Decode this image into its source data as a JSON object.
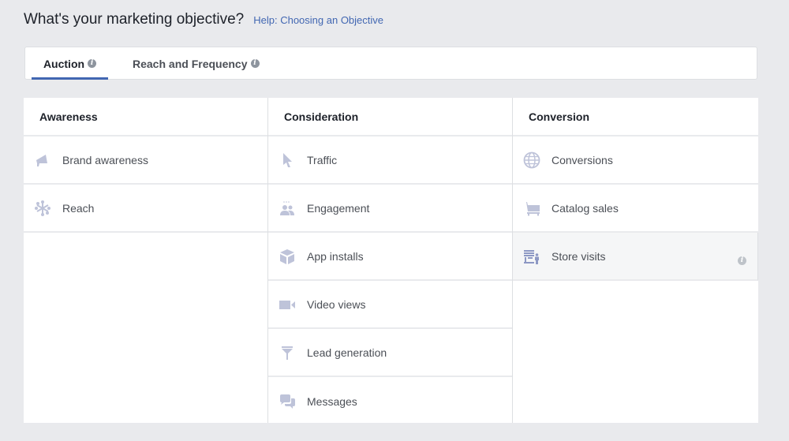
{
  "header": {
    "title": "What's your marketing objective?",
    "help_link": "Help: Choosing an Objective"
  },
  "tabs": [
    {
      "label": "Auction",
      "active": true,
      "info_icon": "info-icon"
    },
    {
      "label": "Reach and Frequency",
      "active": false,
      "info_icon": "info-icon"
    }
  ],
  "colors": {
    "accent": "#4267b2",
    "icon": "#bec3d9",
    "background": "#e9eaed",
    "selected_row": "#f5f6f7"
  },
  "columns": [
    {
      "header": "Awareness",
      "items": [
        {
          "label": "Brand awareness",
          "icon": "megaphone-icon"
        },
        {
          "label": "Reach",
          "icon": "reach-icon"
        }
      ]
    },
    {
      "header": "Consideration",
      "items": [
        {
          "label": "Traffic",
          "icon": "cursor-icon"
        },
        {
          "label": "Engagement",
          "icon": "people-icon"
        },
        {
          "label": "App installs",
          "icon": "box-icon"
        },
        {
          "label": "Video views",
          "icon": "video-camera-icon"
        },
        {
          "label": "Lead generation",
          "icon": "funnel-icon"
        },
        {
          "label": "Messages",
          "icon": "chat-bubbles-icon"
        }
      ]
    },
    {
      "header": "Conversion",
      "items": [
        {
          "label": "Conversions",
          "icon": "globe-icon"
        },
        {
          "label": "Catalog sales",
          "icon": "cart-icon"
        },
        {
          "label": "Store visits",
          "icon": "store-icon",
          "selected": true,
          "info_icon": "info-icon"
        }
      ]
    }
  ]
}
